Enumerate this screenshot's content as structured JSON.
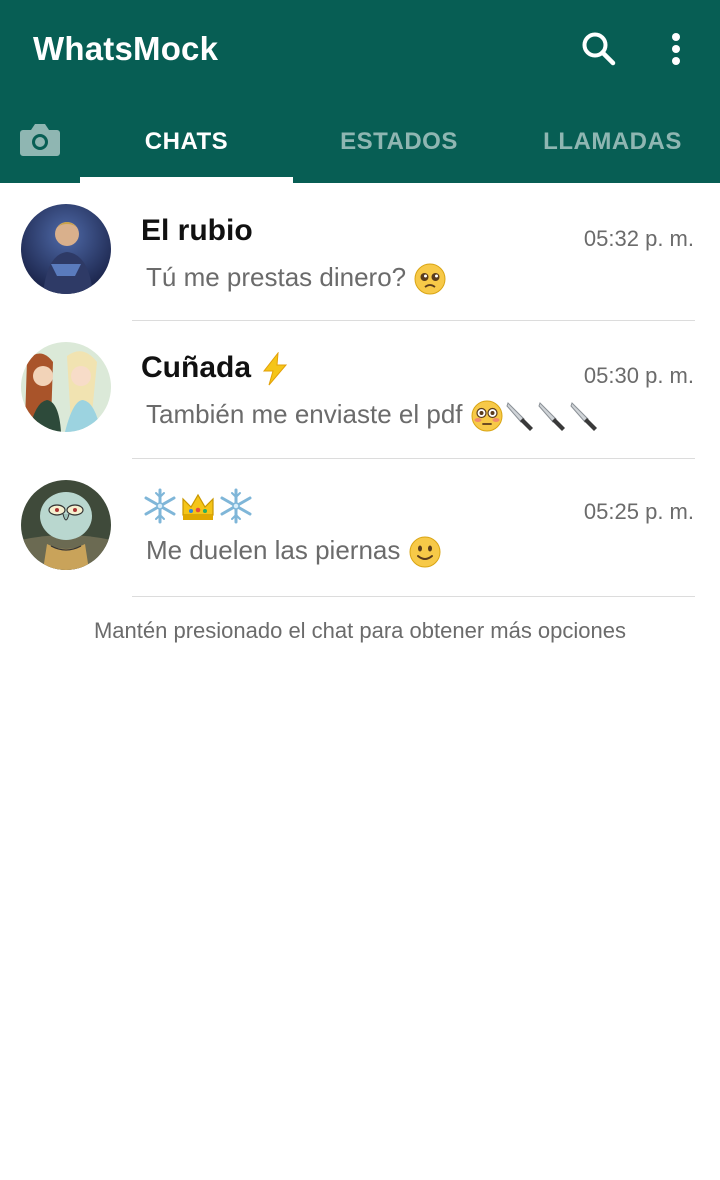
{
  "app": {
    "title": "WhatsMock",
    "brand_color": "#075e54"
  },
  "header": {
    "search_icon": "search-icon",
    "menu_icon": "more-vertical-icon",
    "camera_icon": "camera-icon"
  },
  "tabs": [
    {
      "label": "CHATS",
      "active": true
    },
    {
      "label": "ESTADOS",
      "active": false
    },
    {
      "label": "LLAMADAS",
      "active": false
    }
  ],
  "chats": [
    {
      "name": "El rubio",
      "time": "05:32 p. m.",
      "message": "Tú me prestas dinero?",
      "message_emoji": "pleading-face"
    },
    {
      "name": "Cuñada",
      "name_emoji": "high-voltage",
      "time": "05:30 p. m.",
      "message": "También me enviaste el pdf",
      "message_emoji": "flushed-face, kitchen-knife x3"
    },
    {
      "name_emoji": "snowflake, crown, snowflake",
      "time": "05:25 p. m.",
      "message": "Me duelen las piernas",
      "message_emoji": "slightly-smiling-face"
    }
  ],
  "hint": "Mantén presionado el chat para obtener más opciones"
}
